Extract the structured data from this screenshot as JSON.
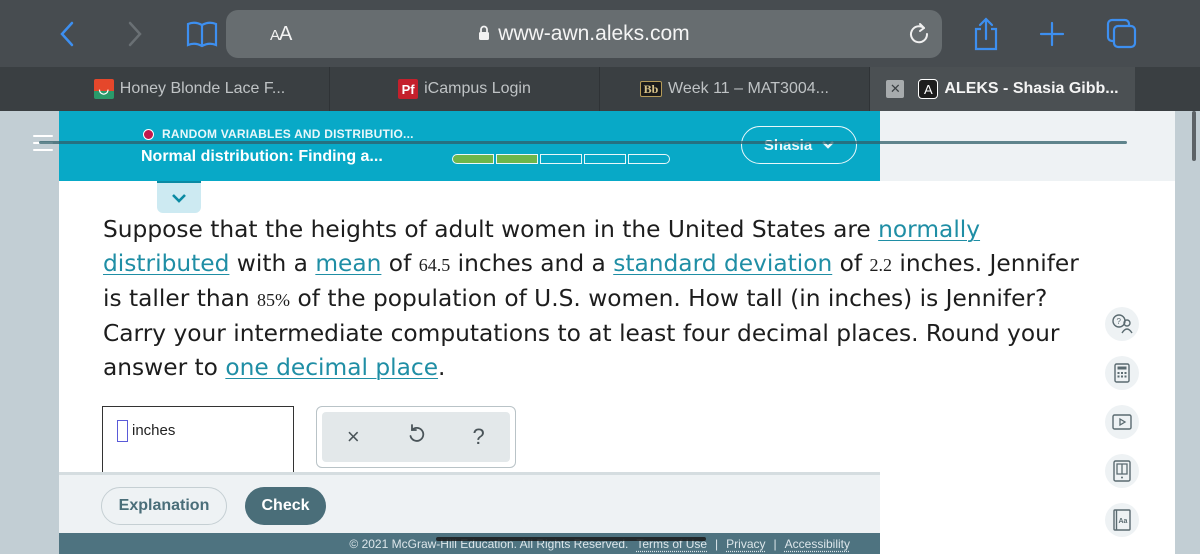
{
  "browser": {
    "address_font_label": "AA",
    "url": "www-awn.aleks.com",
    "icons": [
      "back-chevron",
      "forward-chevron",
      "bookmarks-book",
      "lock",
      "reload",
      "share",
      "new-tab-plus",
      "tabs-overview"
    ],
    "accent_color": "#3d8ff0"
  },
  "tabs": [
    {
      "label": "Honey Blonde Lace F...",
      "favicon": "honey-favicon"
    },
    {
      "label": "iCampus Login",
      "favicon": "Pf"
    },
    {
      "label": "Week 11 – MAT3004...",
      "favicon": "Bb"
    },
    {
      "label": "ALEKS - Shasia Gibb...",
      "favicon": "A",
      "active": true
    }
  ],
  "header": {
    "category": "RANDOM VARIABLES AND DISTRIBUTIO...",
    "topic": "Normal distribution: Finding a...",
    "progress": {
      "completed": 2,
      "total": 5
    },
    "user_name": "Shasia",
    "brand_color": "#08a9c7",
    "progress_color": "#6db64b"
  },
  "question": {
    "t1": "Suppose that the heights of adult women in the United States are ",
    "link_normal": "normally distributed",
    "t2": " with a ",
    "link_mean": "mean",
    "t3": " of ",
    "mean_value": "64.5",
    "t4": " inches and a ",
    "link_sd": "standard deviation",
    "t5": " of ",
    "sd_value": "2.2",
    "t6": " inches. Jennifer is taller than ",
    "percent_value": "85%",
    "t7": " of the population of U.S. women. How tall (in inches) is Jennifer? Carry your intermediate computations to at least four decimal places. Round your answer to ",
    "link_decimal": "one decimal place",
    "t8": "."
  },
  "answer": {
    "value": "",
    "unit": "inches"
  },
  "tools": {
    "clear": "×",
    "undo": "↺",
    "help": "?"
  },
  "actions": {
    "explanation": "Explanation",
    "check": "Check"
  },
  "footer": {
    "copyright": "© 2021 McGraw-Hill Education. All Rights Reserved.",
    "terms": "Terms of Use",
    "privacy": "Privacy",
    "accessibility": "Accessibility",
    "separator": "|"
  },
  "side_tools": [
    "ask-instructor",
    "calculator",
    "video",
    "ebook",
    "dictionary"
  ]
}
